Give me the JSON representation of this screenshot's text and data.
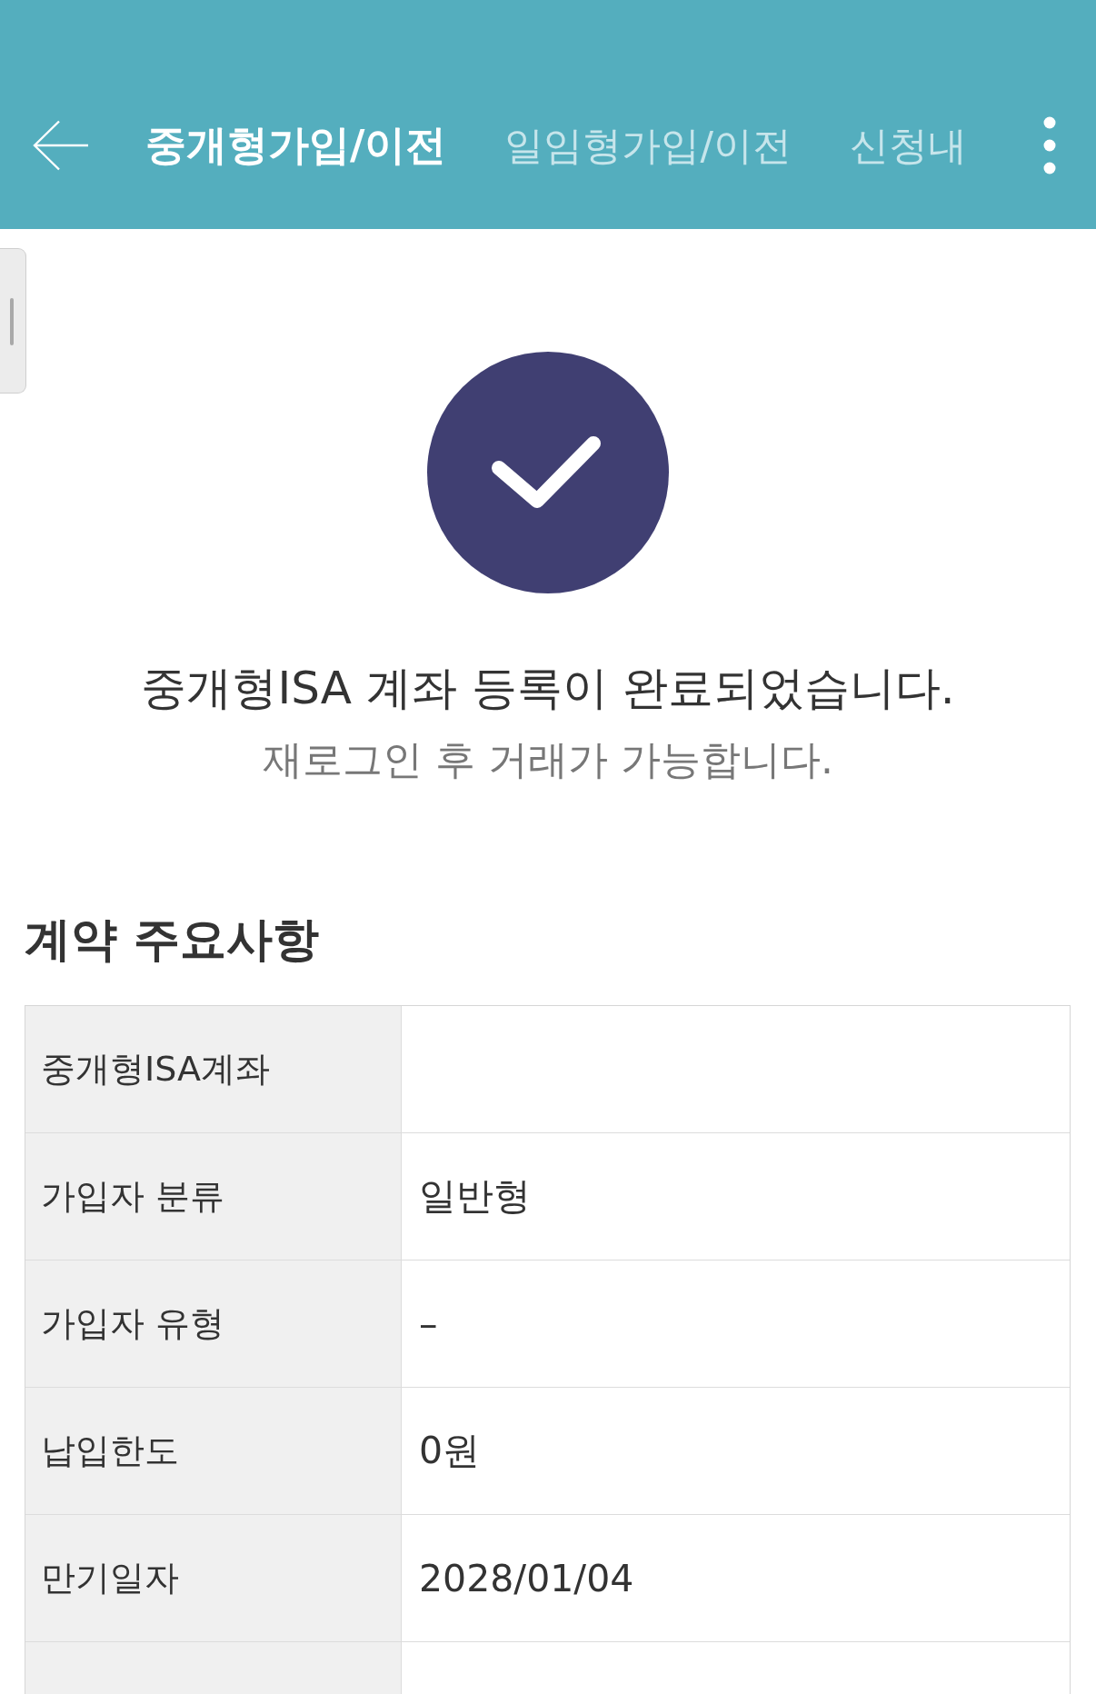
{
  "header": {
    "tabs": [
      {
        "label": "중개형가입/이전",
        "selected": true
      },
      {
        "label": "일임형가입/이전",
        "selected": false
      },
      {
        "label": "신청내",
        "selected": false
      }
    ]
  },
  "result": {
    "title": "중개형ISA 계좌 등록이 완료되었습니다.",
    "subtitle": "재로그인 후 거래가 가능합니다."
  },
  "contract": {
    "heading": "계약 주요사항",
    "rows": [
      {
        "label": "중개형ISA계좌"
      },
      {
        "label": "가입자 분류",
        "value": "일반형"
      },
      {
        "label": "가입자 유형",
        "value": "–"
      },
      {
        "label": "납입한도",
        "value": "0원"
      },
      {
        "label": "만기일자",
        "value": "2028/01/04"
      }
    ],
    "more_rows_below": true
  }
}
